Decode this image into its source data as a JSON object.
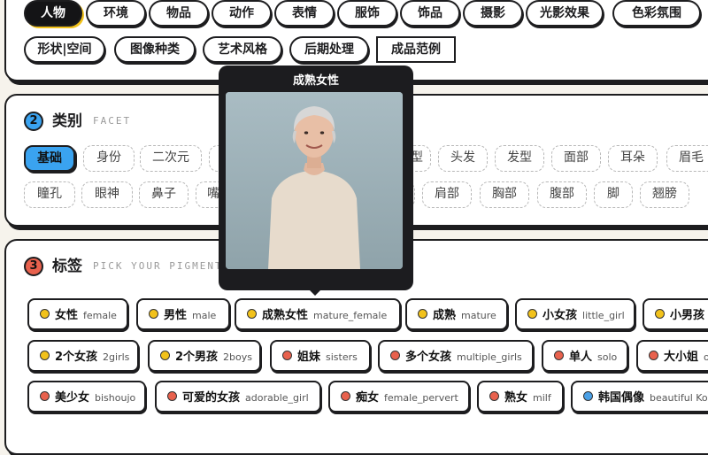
{
  "colors": {
    "accent_blue": "#3aa3f0",
    "dark": "#141416",
    "yellow_dot": "#f2c21b",
    "red_dot": "#e8614d",
    "blue_dot": "#4aa0e6"
  },
  "categories": {
    "row1": [
      "人物",
      "环境",
      "物品",
      "动作",
      "表情",
      "服饰",
      "饰品",
      "摄影",
      "光影效果",
      "色彩氛围"
    ],
    "row2": [
      "形状|空间",
      "图像种类",
      "艺术风格",
      "后期处理",
      "成品范例"
    ],
    "active": "人物"
  },
  "section2": {
    "number": "2",
    "title": "类别",
    "subtitle": "FACET",
    "row1": [
      "基础",
      "身份",
      "二次元",
      "",
      "型",
      "头发",
      "发型",
      "面部",
      "耳朵",
      "眉毛"
    ],
    "row2": [
      "瞳孔",
      "眼神",
      "鼻子",
      "嘴",
      "",
      "肩部",
      "胸部",
      "腹部",
      "脚",
      "翘膀"
    ],
    "active": "基础"
  },
  "section3": {
    "number": "3",
    "title": "标签",
    "subtitle": "PICK YOUR PIGMENTS",
    "tags": [
      [
        {
          "zh": "女性",
          "en": "female",
          "dot": "yellow"
        },
        {
          "zh": "男性",
          "en": "male",
          "dot": "yellow"
        },
        {
          "zh": "成熟女性",
          "en": "mature_female",
          "dot": "yellow"
        },
        {
          "zh": "成熟",
          "en": "mature",
          "dot": "yellow"
        },
        {
          "zh": "小女孩",
          "en": "little_girl",
          "dot": "yellow"
        },
        {
          "zh": "小男孩",
          "en": "",
          "dot": "yellow"
        }
      ],
      [
        {
          "zh": "2个女孩",
          "en": "2girls",
          "dot": "yellow"
        },
        {
          "zh": "2个男孩",
          "en": "2boys",
          "dot": "yellow"
        },
        {
          "zh": "姐妹",
          "en": "sisters",
          "dot": "red"
        },
        {
          "zh": "多个女孩",
          "en": "multiple_girls",
          "dot": "red"
        },
        {
          "zh": "单人",
          "en": "solo",
          "dot": "red"
        },
        {
          "zh": "大小姐",
          "en": "o",
          "dot": "red"
        }
      ],
      [
        {
          "zh": "美少女",
          "en": "bishoujo",
          "dot": "red"
        },
        {
          "zh": "可爱的女孩",
          "en": "adorable_girl",
          "dot": "red"
        },
        {
          "zh": "痴女",
          "en": "female_pervert",
          "dot": "red"
        },
        {
          "zh": "熟女",
          "en": "milf",
          "dot": "red"
        },
        {
          "zh": "韩国偶像",
          "en": "beautiful Kor",
          "dot": "blue"
        }
      ]
    ]
  },
  "tooltip": {
    "title": "成熟女性",
    "image_alt": "elderly woman portrait"
  }
}
